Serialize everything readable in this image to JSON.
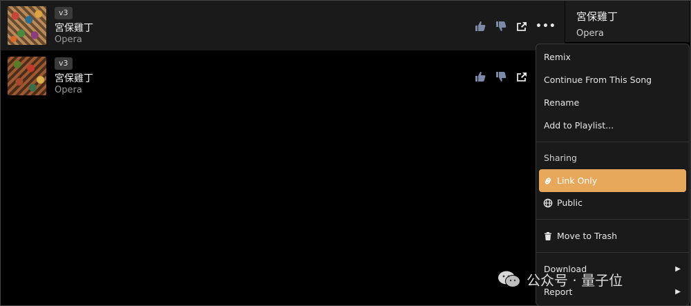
{
  "songs": [
    {
      "version": "v3",
      "title": "宮保雞丁",
      "genre": "Opera"
    },
    {
      "version": "v3",
      "title": "宮保雞丁",
      "genre": "Opera"
    }
  ],
  "row_icons": [
    "thumbs-up-icon",
    "thumbs-down-icon",
    "share-icon",
    "more-icon"
  ],
  "more_label": "•••",
  "side_panel": {
    "title": "宮保雞丁",
    "genre": "Opera"
  },
  "menu": {
    "remix": "Remix",
    "continue": "Continue From This Song",
    "rename": "Rename",
    "add_playlist": "Add to Playlist...",
    "sharing_label": "Sharing",
    "link_only": "Link Only",
    "public": "Public",
    "move_to_trash": "Move to Trash",
    "download": "Download",
    "report": "Report",
    "submenu_arrow": "▶"
  },
  "colors": {
    "highlight": "#e8a85c",
    "icon_dim": "#7c8aa8"
  },
  "watermark": {
    "text": "公众号 · 量子位"
  }
}
